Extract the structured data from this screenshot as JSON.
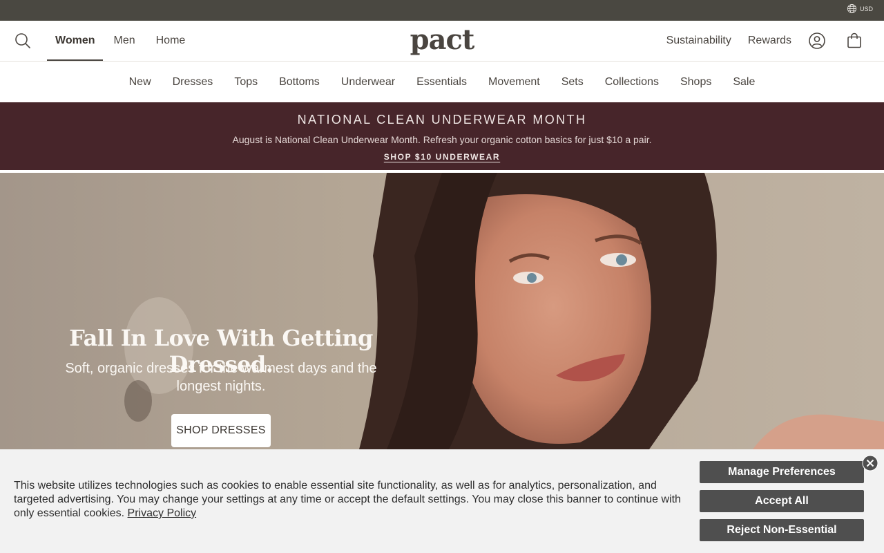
{
  "utility": {
    "currency": "USD",
    "currency_icon": "globe-icon"
  },
  "header": {
    "search_icon": "search-icon",
    "gender_tabs": [
      "Women",
      "Men",
      "Home"
    ],
    "logo": "pact",
    "right_links": [
      "Sustainability",
      "Rewards"
    ],
    "account_icon": "account-icon",
    "cart_icon": "cart-icon"
  },
  "categories": [
    "New",
    "Dresses",
    "Tops",
    "Bottoms",
    "Underwear",
    "Essentials",
    "Movement",
    "Sets",
    "Collections",
    "Shops",
    "Sale"
  ],
  "promo": {
    "title": "NATIONAL CLEAN UNDERWEAR MONTH",
    "text": "August is National Clean Underwear Month. Refresh your organic cotton basics for just $10 a pair.",
    "link": "SHOP $10 UNDERWEAR",
    "background": "#47252a"
  },
  "hero": {
    "title": "Fall In Love With Getting Dressed.",
    "subtitle": "Soft, organic dresses for the warmest days and the longest nights.",
    "cta": "SHOP DRESSES"
  },
  "cookie": {
    "text": "This website utilizes technologies such as cookies to enable essential site functionality, as well as for analytics, personalization, and targeted advertising. You may change your settings at any time or accept the default settings. You may close this banner to continue with only essential cookies.",
    "policy_link": "Privacy Policy",
    "buttons": {
      "manage": "Manage Preferences",
      "accept": "Accept All",
      "reject": "Reject Non-Essential"
    },
    "close_icon": "close-icon"
  }
}
